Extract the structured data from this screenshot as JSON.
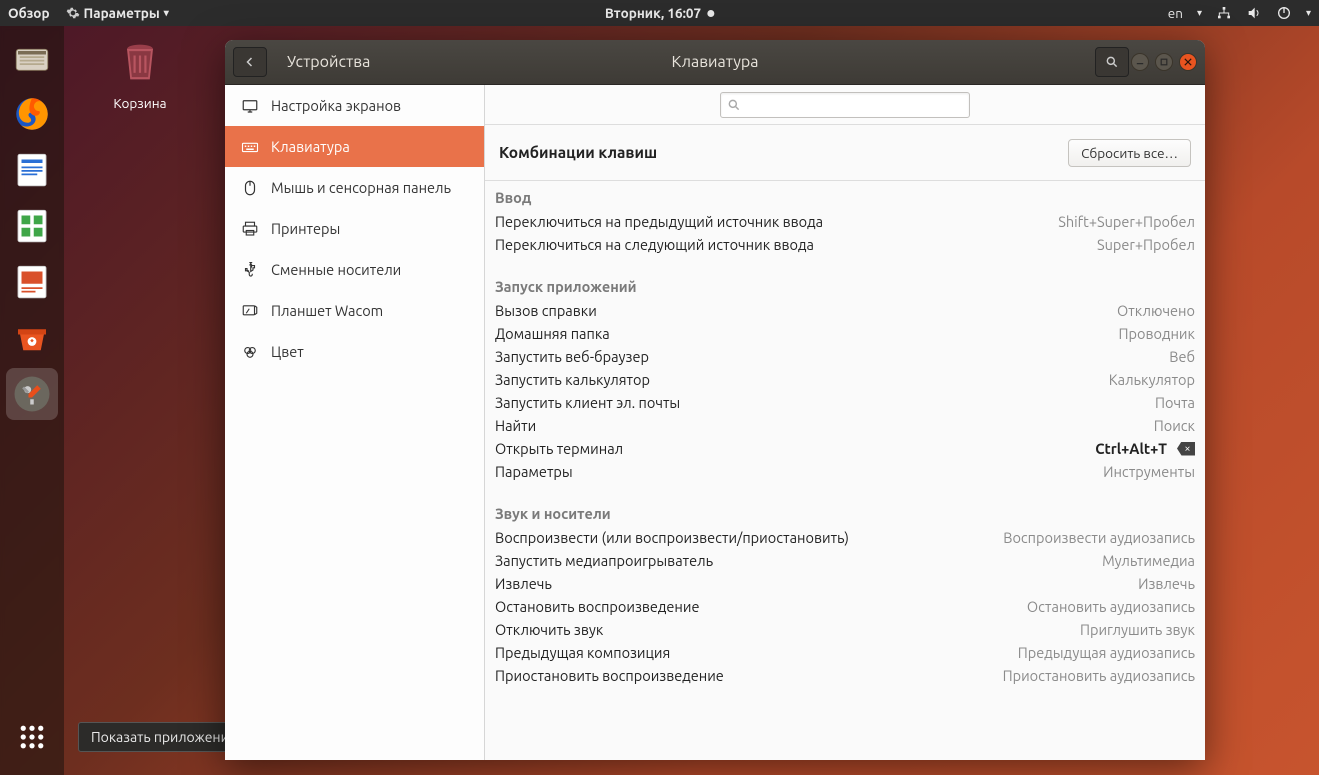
{
  "topbar": {
    "overview": "Обзор",
    "params": "Параметры",
    "clock": "Вторник, 16:07",
    "lang": "en"
  },
  "desktop": {
    "trash_label": "Корзина"
  },
  "tooltip": {
    "show_apps": "Показать приложения"
  },
  "window": {
    "section": "Устройства",
    "title": "Клавиатура",
    "search_placeholder": ""
  },
  "sidebar": {
    "items": [
      {
        "icon": "display",
        "label": "Настройка экранов"
      },
      {
        "icon": "keyboard",
        "label": "Клавиатура",
        "active": true
      },
      {
        "icon": "mouse",
        "label": "Мышь и сенсорная панель"
      },
      {
        "icon": "printer",
        "label": "Принтеры"
      },
      {
        "icon": "usb",
        "label": "Сменные носители"
      },
      {
        "icon": "tablet",
        "label": "Планшет Wacom"
      },
      {
        "icon": "color",
        "label": "Цвет"
      }
    ]
  },
  "content": {
    "heading": "Комбинации клавиш",
    "reset": "Сбросить все…",
    "sections": [
      {
        "title": "Ввод",
        "rows": [
          {
            "name": "Переключиться на предыдущий источник ввода",
            "value": "Shift+Super+Пробел"
          },
          {
            "name": "Переключиться на следующий источник ввода",
            "value": "Super+Пробел"
          }
        ]
      },
      {
        "title": "Запуск приложений",
        "rows": [
          {
            "name": "Вызов справки",
            "value": "Отключено"
          },
          {
            "name": "Домашняя папка",
            "value": "Проводник"
          },
          {
            "name": "Запустить веб-браузер",
            "value": "Веб"
          },
          {
            "name": "Запустить калькулятор",
            "value": "Калькулятор"
          },
          {
            "name": "Запустить клиент эл. почты",
            "value": "Почта"
          },
          {
            "name": "Найти",
            "value": "Поиск"
          },
          {
            "name": "Открыть терминал",
            "value": "Ctrl+Alt+T",
            "strong": true,
            "removable": true
          },
          {
            "name": "Параметры",
            "value": "Инструменты"
          }
        ]
      },
      {
        "title": "Звук и носители",
        "rows": [
          {
            "name": "Воспроизвести (или воспроизвести/приостановить)",
            "value": "Воспроизвести аудиозапись"
          },
          {
            "name": "Запустить медиапроигрыватель",
            "value": "Мультимедиа"
          },
          {
            "name": "Извлечь",
            "value": "Извлечь"
          },
          {
            "name": "Остановить воспроизведение",
            "value": "Остановить аудиозапись"
          },
          {
            "name": "Отключить звук",
            "value": "Приглушить звук"
          },
          {
            "name": "Предыдущая композиция",
            "value": "Предыдущая аудиозапись"
          },
          {
            "name": "Приостановить воспроизведение",
            "value": "Приостановить аудиозапись"
          }
        ]
      }
    ]
  }
}
